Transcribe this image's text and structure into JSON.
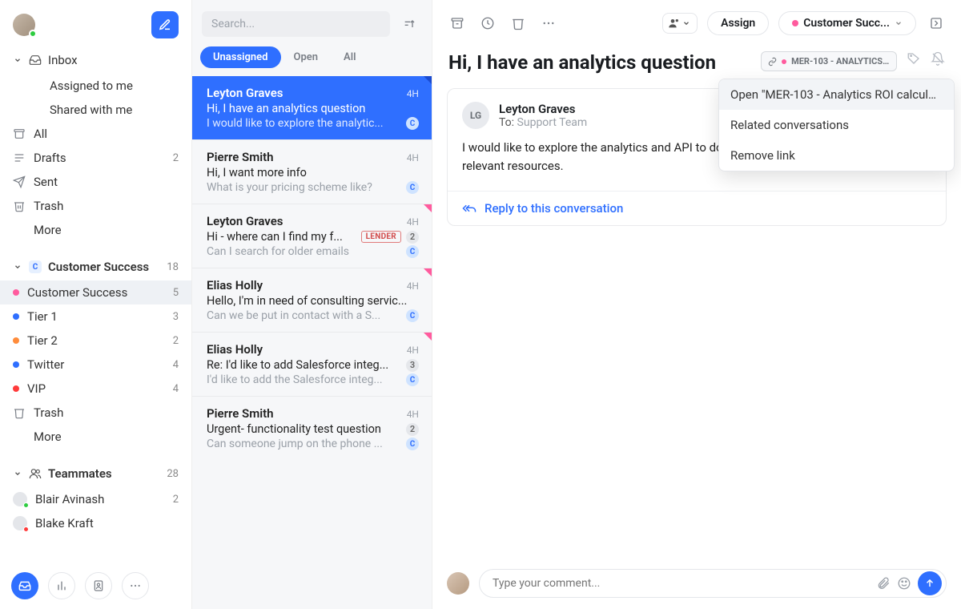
{
  "sidebar": {
    "inbox_label": "Inbox",
    "assigned_label": "Assigned to me",
    "shared_label": "Shared with me",
    "workspace": {
      "all": {
        "label": "All"
      },
      "drafts": {
        "label": "Drafts",
        "count": "2"
      },
      "sent": {
        "label": "Sent"
      },
      "trash": {
        "label": "Trash"
      },
      "more": {
        "label": "More"
      }
    },
    "cs": {
      "title": "Customer Success",
      "count": "18",
      "items": [
        {
          "label": "Customer Success",
          "count": "5",
          "color": "#ff5b9e"
        },
        {
          "label": "Tier 1",
          "count": "3",
          "color": "#2f6fff"
        },
        {
          "label": "Tier 2",
          "count": "2",
          "color": "#ff8c3b"
        },
        {
          "label": "Twitter",
          "count": "4",
          "color": "#2f6fff"
        },
        {
          "label": "VIP",
          "count": "4",
          "color": "#ff3b3b"
        }
      ],
      "trash": "Trash",
      "more": "More"
    },
    "teammates": {
      "title": "Teammates",
      "count": "28",
      "items": [
        {
          "label": "Blair Avinash",
          "count": "2",
          "presence": "#2ecc40"
        },
        {
          "label": "Blake Kraft",
          "presence": "#ff3b3b"
        }
      ]
    }
  },
  "threadlist": {
    "search_placeholder": "Search...",
    "tabs": {
      "unassigned": "Unassigned",
      "open": "Open",
      "all": "All"
    },
    "threads": [
      {
        "from": "Leyton Graves",
        "time": "4H",
        "subject": "Hi, I have an analytics question",
        "preview": "I would like to explore the analytic...",
        "badge": "C",
        "selected": true,
        "corner": true
      },
      {
        "from": "Pierre Smith",
        "time": "4H",
        "subject": "Hi, I want more info",
        "preview": "What is your pricing scheme like?",
        "badge": "C"
      },
      {
        "from": "Leyton Graves",
        "time": "4H",
        "subject": "Hi - where can I find my f...",
        "preview": "Can I search for older emails",
        "tag": "LENDER",
        "count": "2",
        "badge": "C",
        "corner": true
      },
      {
        "from": "Elias Holly",
        "time": "4H",
        "subject": "Hello, I'm in need of consulting servic...",
        "preview": "Can we be put in contact with a S...",
        "badge": "C",
        "corner": true
      },
      {
        "from": "Elias Holly",
        "time": "4H",
        "subject": "Re: I'd like to add Salesforce integ...",
        "preview": "I'd like to add the Salesforce integ...",
        "count": "3",
        "badge": "C",
        "corner": true
      },
      {
        "from": "Pierre Smith",
        "time": "4H",
        "subject": "Urgent- functionality test question",
        "preview": "Can someone jump on the phone ...",
        "count": "2",
        "badge": "C"
      }
    ]
  },
  "reader": {
    "assign_label": "Assign",
    "cs_label": "Customer Succ...",
    "title": "Hi, I have an analytics question",
    "link_pill": "MER-103 - ANALYTICS R...",
    "dropdown": {
      "open": "Open \"MER-103 - Analytics ROI calculat...",
      "related": "Related conversations",
      "remove": "Remove link"
    },
    "message": {
      "initials": "LG",
      "name": "Leyton Graves",
      "to_label": "To:",
      "to_value": "Support Team",
      "body": "I would like to explore the analytics and API to do a ROI analysis, please send along relevant resources."
    },
    "reply_label": "Reply to this conversation",
    "composer_placeholder": "Type your comment..."
  }
}
